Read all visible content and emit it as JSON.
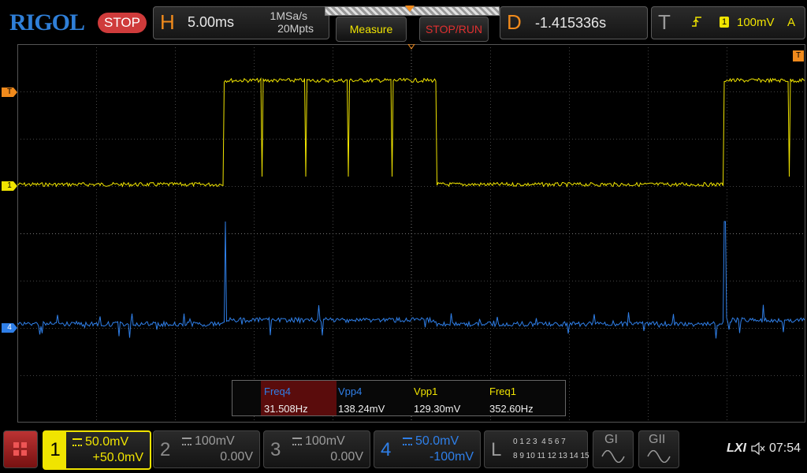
{
  "brand": "RIGOL",
  "run_state": "STOP",
  "horizontal": {
    "letter": "H",
    "timebase": "5.00ms",
    "sample_rate": "1MSa/s",
    "memory_depth": "20Mpts"
  },
  "buttons": {
    "measure": "Measure",
    "stop_run": "STOP/RUN"
  },
  "delay": {
    "letter": "D",
    "value": "-1.415336s"
  },
  "trigger": {
    "letter": "T",
    "source": "1",
    "level": "100mV",
    "mode": "A"
  },
  "markers": {
    "trigger_level": "T",
    "ch1": "1",
    "ch4": "4",
    "trigger_pos": "T"
  },
  "measurements": [
    {
      "label": "Freq4",
      "value": "31.508Hz",
      "color": "#2f7fe8",
      "highlighted": true
    },
    {
      "label": "Vpp4",
      "value": "138.24mV",
      "color": "#2f7fe8",
      "highlighted": false
    },
    {
      "label": "Vpp1",
      "value": "129.30mV",
      "color": "#f0e400",
      "highlighted": false
    },
    {
      "label": "Freq1",
      "value": "352.60Hz",
      "color": "#f0e400",
      "highlighted": false
    }
  ],
  "channels": [
    {
      "num": "1",
      "scale": "50.0mV",
      "offset": "+50.0mV",
      "color": "#f0e400",
      "active": true
    },
    {
      "num": "2",
      "scale": "100mV",
      "offset": "0.00V",
      "color": "#9a9a9a",
      "active": false
    },
    {
      "num": "3",
      "scale": "100mV",
      "offset": "0.00V",
      "color": "#9a9a9a",
      "active": false
    },
    {
      "num": "4",
      "scale": "50.0mV",
      "offset": "-100mV",
      "color": "#2f7fe8",
      "active": true
    }
  ],
  "logic": {
    "letter": "L",
    "row1": "0 1 2 3  4 5 6 7",
    "row2": "8 9 10 11 12 13 14 15"
  },
  "generators": [
    "GI",
    "GII"
  ],
  "lxi": "LXI",
  "clock": "07:54",
  "colors": {
    "ch1": "#f0e400",
    "ch4": "#2f7fe8",
    "accent": "#f08a1c",
    "stop": "#cf3b3b"
  }
}
